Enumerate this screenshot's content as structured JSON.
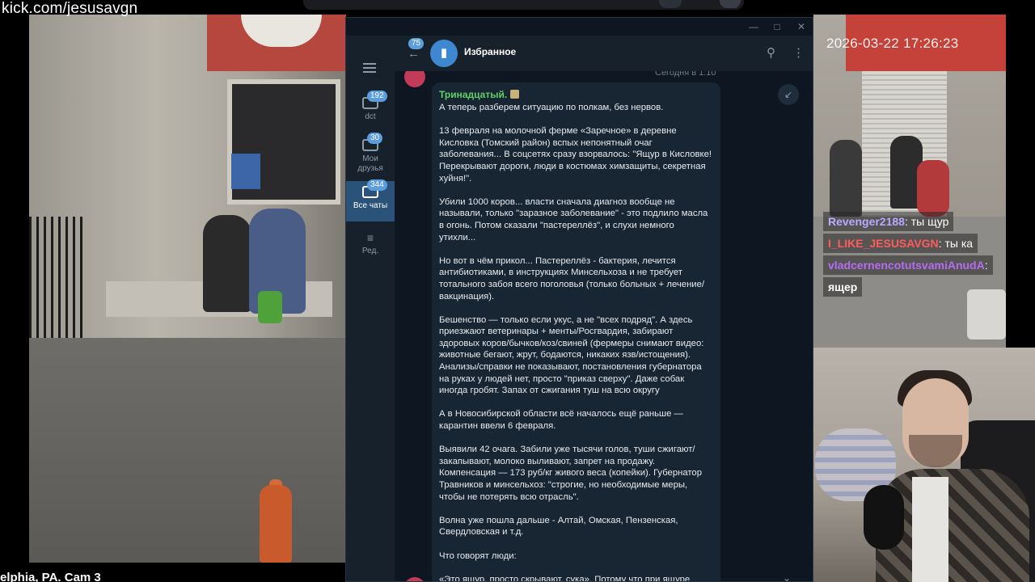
{
  "stream": {
    "url": "kick.com/jesusavgn",
    "left_cam_label": "elphia, PA. Cam 3",
    "right_cam_timestamp": "2026-03-22 17:26:23",
    "chat_overlay": [
      {
        "user": "Revenger2188",
        "text": ": ты щур",
        "color": "#b9a9ff"
      },
      {
        "user": "I_LIKE_JESUSAVGN",
        "text": ": ты ка",
        "color": "#ff5b5b"
      },
      {
        "user": "vladcernencotutsvamiAnudA",
        "text": ": ",
        "color": "#b56cf2",
        "continuation": "ящер"
      }
    ]
  },
  "telegram": {
    "sidebar": {
      "folders": [
        {
          "label": "dct",
          "badge": "192",
          "active": false
        },
        {
          "label": "Мои друзья",
          "badge": "30",
          "active": false
        },
        {
          "label": "Все чаты",
          "badge": "344",
          "active": true
        },
        {
          "label": "Ред.",
          "badge": "",
          "active": false
        }
      ]
    },
    "header": {
      "back_badge": "75",
      "title": "Избранное"
    },
    "prev_message_time": "Сегодня в 1:10",
    "message": {
      "author": "Тринадцатый.",
      "paragraphs": [
        "А теперь разберем ситуацию по полкам, без нервов.",
        "13 февраля на молочной ферме «Заречное» в деревне Кисловка (Томский район) вспых непонятный очаг заболевания... В соцсетях сразу взорвалось: \"Ящур в Кисловке! Перекрывают дороги, люди в костюмах химзащиты, секретная хуйня!\".",
        "Убили 1000 коров... власти сначала диагноз вообще не называли, только \"заразное заболевание\" - это подлило масла в огонь. Потом сказали \"пастереллёз\", и слухи немного утихли...",
        "Но вот в чём прикол... Пастереллёз - бактерия, лечится антибиотиками, в инструкциях Минсельхоза и не требует тотального забоя всего поголовья (только больных + лечение/вакцинация).",
        "Бешенство — только если укус, а не \"всех подряд\". А здесь приезжают ветеринары + менты/Росгвардия, забирают здоровых коров/бычков/коз/свиней (фермеры снимают видео: животные бегают, жрут, бодаются, никаких язв/истощения). Анализы/справки не показывают, постановления губернатора на руках у людей нет, просто \"приказ сверху\". Даже собак иногда гробят. Запах от сжигания туш на всю округу",
        "А в Новосибирской области всё началось ещё раньше — карантин ввели 6 февраля.",
        "Выявили 42 очага. Забили уже тысячи голов, туши сжигают/закапывают, молоко выливают, запрет на продажу. Компенсация — 173 руб/кг живого веса (копейки). Губернатор Травников и минсельхоз: \"строгие, но необходимые меры, чтобы не потерять всю отрасль\".",
        "Волна уже пошла дальше - Алтай, Омская, Пензенская, Свердловская и т.д.",
        "Что говорят люди:",
        "«Это ящур, просто скрывают, сука». Потому что при ящуре (вирус, очень заразный, поражает копытных + людей слегка) - именно такой протокол: забой ВСЕГО в очаге + радиус,"
      ]
    }
  }
}
